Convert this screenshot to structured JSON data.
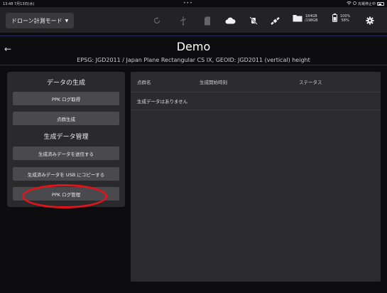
{
  "status_bar": {
    "time": "13:48  7月13日(水)",
    "dots": "•••",
    "status_text": "充電停止中"
  },
  "toolbar": {
    "mode_label": "ドローン計測モード",
    "storage_used": "184GB",
    "storage_total": "/198GB",
    "battery_1": "100%",
    "battery_2": "58%"
  },
  "header": {
    "title": "Demo",
    "subtitle": "EPSG: JGD2011 / Japan Plane Rectangular CS IX, GEOID: JGD2011 (vertical) height"
  },
  "left_panel": {
    "section_generate": "データの生成",
    "ppk_log_get": "PPK ログ取得",
    "point_cloud": "点群生成",
    "section_manage": "生成データ管理",
    "send_data": "生成済みデータを送信する",
    "copy_usb": "生成済みデータを USB にコピーする",
    "ppk_log_manage": "PPK ログ管理"
  },
  "table": {
    "columns": [
      "点群名",
      "生成開始時刻",
      "ステータス"
    ],
    "empty_message": "生成データはありません"
  },
  "colors": {
    "highlight": "#e0141a",
    "panel": "#2a2a2d",
    "button": "#4a4a4e"
  }
}
